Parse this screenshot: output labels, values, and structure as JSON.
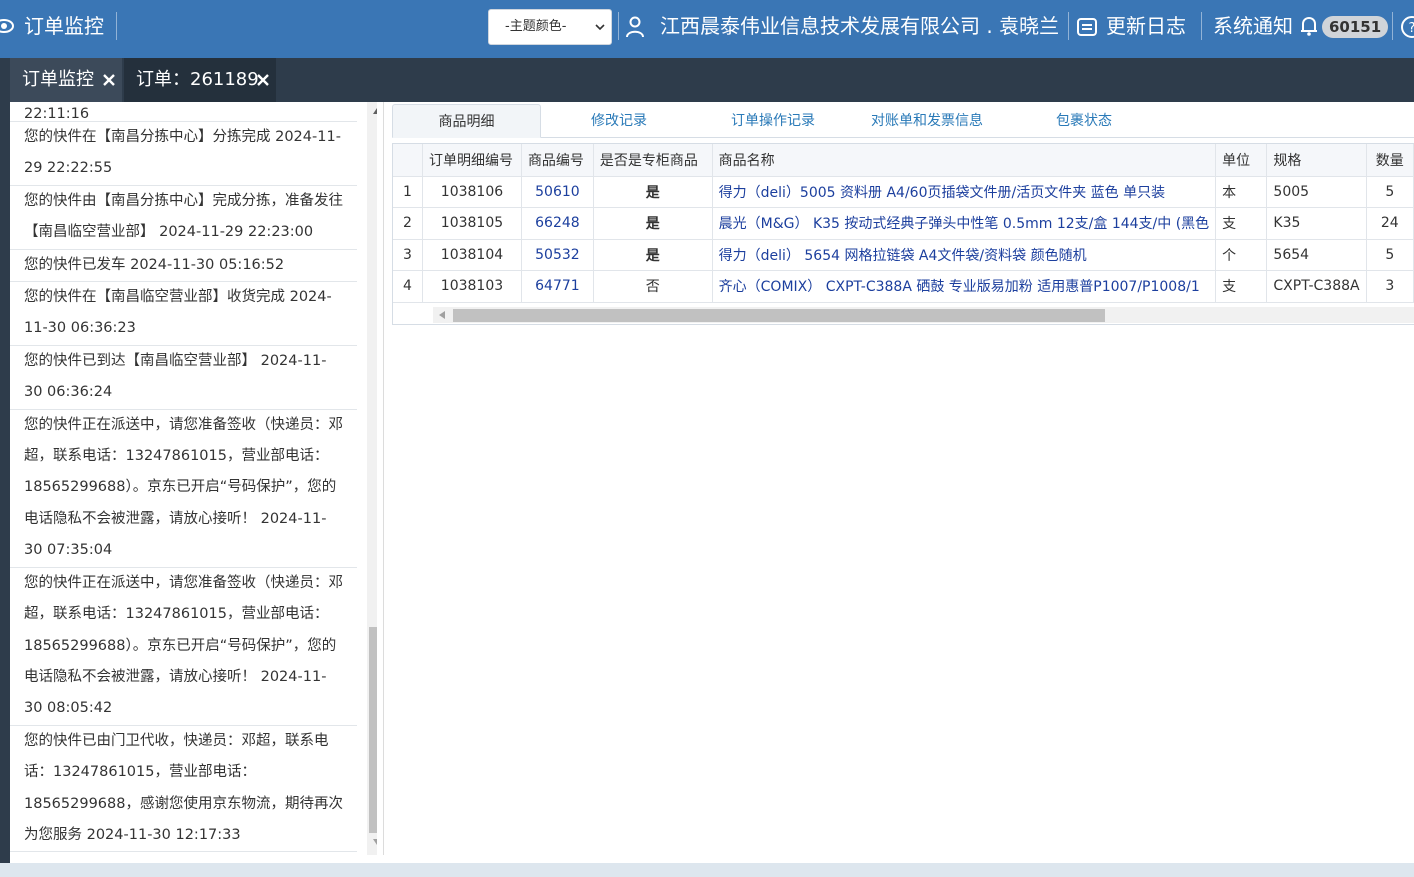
{
  "header": {
    "app_title": "订单监控",
    "theme_select": "-主题颜色-",
    "company_user": "江西晨泰伟业信息技术发展有限公司 . 袁晓兰",
    "changelog": "更新日志",
    "notifications": "系统通知",
    "notification_count": "60151"
  },
  "tabs": [
    {
      "label": "订单监控"
    },
    {
      "label": "订单：261189"
    }
  ],
  "tracking": {
    "items": [
      "22:11:16",
      "您的快件在【南昌分拣中心】分拣完成 2024-11-29 22:22:55",
      "您的快件由【南昌分拣中心】完成分拣，准备发往【南昌临空营业部】 2024-11-29 22:23:00",
      "您的快件已发车 2024-11-30 05:16:52",
      "您的快件在【南昌临空营业部】收货完成 2024-11-30 06:36:23",
      "您的快件已到达【南昌临空营业部】 2024-11-30 06:36:24",
      "您的快件正在派送中，请您准备签收（快递员：邓超，联系电话：13247861015，营业部电话：18565299688）。京东已开启“号码保护”，您的电话隐私不会被泄露，请放心接听！ 2024-11-30 07:35:04",
      "您的快件正在派送中，请您准备签收（快递员：邓超，联系电话：13247861015，营业部电话：18565299688）。京东已开启“号码保护”，您的电话隐私不会被泄露，请放心接听！ 2024-11-30 08:05:42",
      "您的快件已由门卫代收，快递员：邓超，联系电话：13247861015，营业部电话：18565299688，感谢您使用京东物流，期待再次为您服务 2024-11-30 12:17:33"
    ]
  },
  "subtabs": [
    "商品明细",
    "修改记录",
    "订单操作记录",
    "对账单和发票信息",
    "包裹状态"
  ],
  "table": {
    "columns": [
      "",
      "订单明细编号",
      "商品编号",
      "是否是专柜商品",
      "商品名称",
      "单位",
      "规格",
      "数量"
    ],
    "rows": [
      [
        "1",
        "1038106",
        "50610",
        "是",
        "得力（deli）5005 资料册 A4/60页插袋文件册/活页文件夹 蓝色 单只装",
        "本",
        "5005",
        "5"
      ],
      [
        "2",
        "1038105",
        "66248",
        "是",
        "晨光（M&G） K35 按动式经典子弹头中性笔 0.5mm 12支/盒 144支/中 (黑色",
        "支",
        "K35",
        "24"
      ],
      [
        "3",
        "1038104",
        "50532",
        "是",
        "得力（deli） 5654 网格拉链袋 A4文件袋/资料袋 颜色随机",
        "个",
        "5654",
        "5"
      ],
      [
        "4",
        "1038103",
        "64771",
        "否",
        "齐心（COMIX） CXPT-C388A 硒鼓 专业版易加粉 适用惠普P1007/P1008/1",
        "支",
        "CXPT-C388A",
        "3"
      ]
    ]
  }
}
